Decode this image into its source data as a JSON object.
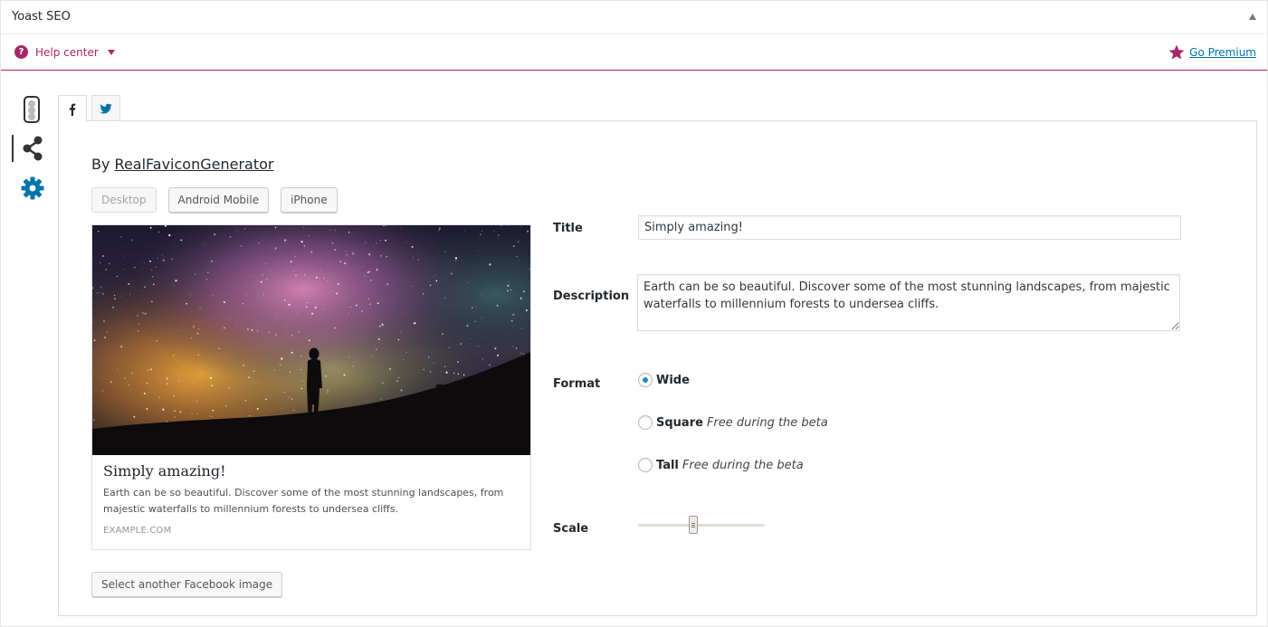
{
  "metabox": {
    "title": "Yoast SEO"
  },
  "helpbar": {
    "help_label": "Help center",
    "premium_label": "Go Premium"
  },
  "colors": {
    "yoast_purple": "#a4286a",
    "link_blue": "#0073aa",
    "nav_blue": "#0073aa"
  },
  "sidenav": {
    "items": [
      {
        "icon": "traffic-light-icon",
        "active": false
      },
      {
        "icon": "share-icon",
        "active": true
      },
      {
        "icon": "gear-icon",
        "active": false
      }
    ]
  },
  "tabs": [
    {
      "icon": "facebook-icon",
      "active": true
    },
    {
      "icon": "twitter-icon",
      "active": false
    }
  ],
  "preview": {
    "by_prefix": "By",
    "by_link": "RealFaviconGenerator",
    "devices": [
      "Desktop",
      "Android Mobile",
      "iPhone"
    ],
    "active_device": "Desktop",
    "card": {
      "title": "Simply amazing!",
      "description": "Earth can be so beautiful. Discover some of the most stunning landscapes, from majestic waterfalls to millennium forests to undersea cliffs.",
      "domain": "EXAMPLE.COM"
    },
    "select_image_label": "Select another Facebook image"
  },
  "form": {
    "title_label": "Title",
    "title_value": "Simply amazing!",
    "description_label": "Description",
    "description_value": "Earth can be so beautiful. Discover some of the most stunning landscapes, from majestic waterfalls to millennium forests to undersea cliffs.",
    "format_label": "Format",
    "formats": [
      {
        "label": "Wide",
        "note": "",
        "checked": true
      },
      {
        "label": "Square",
        "note": "Free during the beta",
        "checked": false
      },
      {
        "label": "Tall",
        "note": "Free during the beta",
        "checked": false
      }
    ],
    "scale_label": "Scale",
    "scale_value": 0.43
  }
}
